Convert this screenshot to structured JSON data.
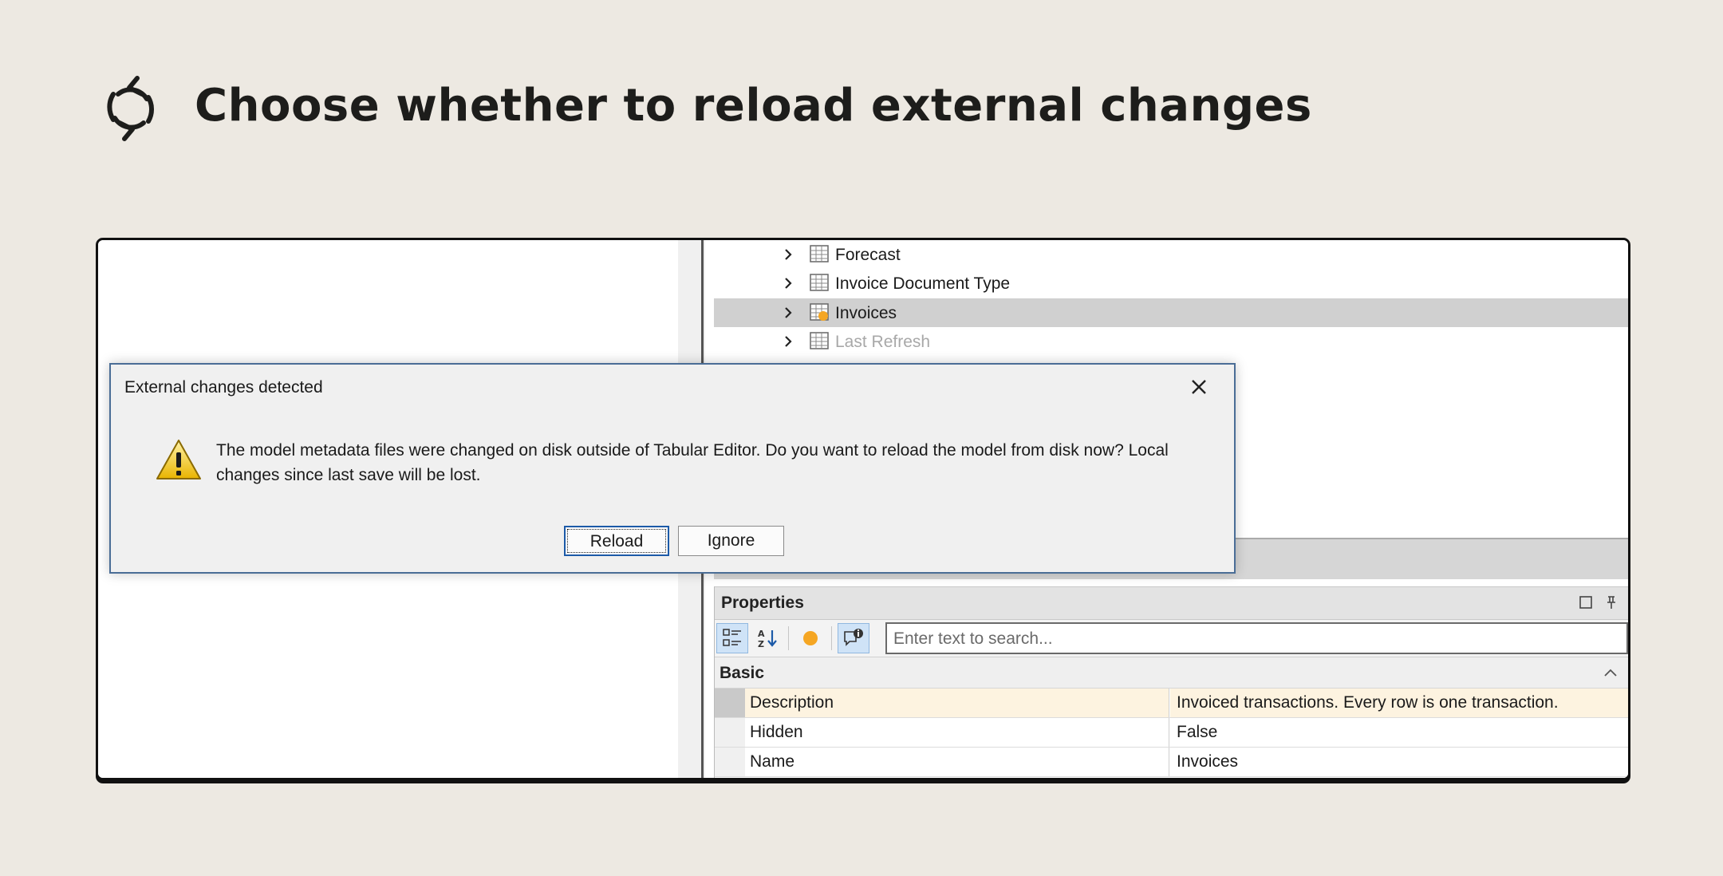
{
  "page": {
    "title": "Choose whether to reload external changes",
    "icon": "refresh-icon"
  },
  "tree": {
    "items": [
      {
        "label": "Forecast",
        "icon": "table-icon",
        "selected": false,
        "dim": false
      },
      {
        "label": "Invoice Document Type",
        "icon": "table-icon",
        "selected": false,
        "dim": false
      },
      {
        "label": "Invoices",
        "icon": "table-modified-icon",
        "selected": true,
        "dim": false
      },
      {
        "label": "Last Refresh",
        "icon": "table-icon",
        "selected": false,
        "dim": true
      }
    ]
  },
  "dialog": {
    "title": "External changes detected",
    "message": "The model metadata files were changed on disk outside of Tabular Editor. Do you want to reload the model from disk now? Local changes since last save will be lost.",
    "reload_label": "Reload",
    "ignore_label": "Ignore",
    "icon": "warning-icon"
  },
  "properties": {
    "title": "Properties",
    "search_placeholder": "Enter text to search...",
    "category": "Basic",
    "rows": [
      {
        "key": "Description",
        "value": "Invoiced transactions. Every row is one transaction.",
        "selected": true
      },
      {
        "key": "Hidden",
        "value": "False",
        "selected": false
      },
      {
        "key": "Name",
        "value": "Invoices",
        "selected": false
      }
    ]
  },
  "colors": {
    "background": "#ede9e2",
    "accent": "#1c5aa8",
    "modified_dot": "#f5a623",
    "selected_row": "#fdf3e0"
  }
}
